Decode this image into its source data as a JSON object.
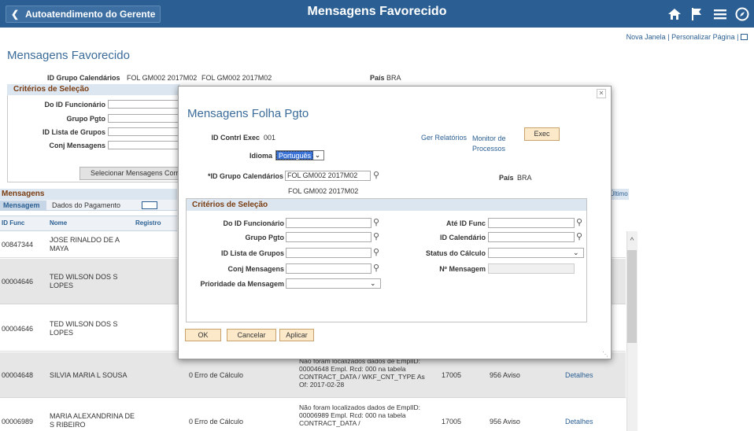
{
  "header": {
    "back_label": "Autoatendimento do Gerente",
    "title": "Mensagens Favorecido"
  },
  "page_links": {
    "new_window": "Nova Janela",
    "separator": "|",
    "personalize": "Personalizar Página",
    "separator2": "|"
  },
  "background": {
    "title": "Mensagens Favorecido",
    "id_grupo_label": "ID Grupo Calendários",
    "id_grupo_value": "FOL GM002 2017M02",
    "id_grupo_desc": "FOL GM002 2017M02",
    "pais_label": "País",
    "pais_value": "BRA",
    "criteria_title": "Critérios de Seleção",
    "fields": [
      "Do ID Funcionário",
      "Grupo Pgto",
      "ID Lista de Grupos",
      "Conj Mensagens"
    ],
    "select_button": "Selecionar Mensagens Correspondentes",
    "messages_title": "Mensagens",
    "ultimo": "Último",
    "tabs": [
      "Mensagem",
      "Dados do Pagamento"
    ],
    "columns": [
      "ID Func",
      "Nome",
      "Registro"
    ],
    "rows": [
      {
        "id": "00847344",
        "name": "JOSE RINALDO DE A MAYA"
      },
      {
        "id": "00004646",
        "name": "TED WILSON DOS S LOPES"
      },
      {
        "id": "00004646",
        "name": "TED WILSON DOS S LOPES"
      },
      {
        "id": "00004648",
        "name": "SILVIA MARIA L SOUSA",
        "reg": "0",
        "error": "Erro de Cálculo",
        "msg": "Não foram localizados dados de EmplID: 00004648 Empl. Rcd: 000 na tabela CONTRACT_DATA / WKF_CNT_TYPE As Of: 2017-02-28",
        "set": "17005",
        "num": "956",
        "sev": "Aviso",
        "detail": "Detalhes"
      },
      {
        "id": "00006989",
        "name": "MARIA ALEXANDRINA DE S RIBEIRO",
        "reg": "0",
        "error": "Erro de Cálculo",
        "msg": "Não foram localizados dados de EmplID: 00006989 Empl. Rcd: 000 na tabela CONTRACT_DATA /",
        "set": "17005",
        "num": "956",
        "sev": "Aviso",
        "detail": "Detalhes"
      }
    ]
  },
  "modal": {
    "title": "Mensagens Folha Pgto",
    "run_control_label": "ID Contrl Exec",
    "run_control_value": "001",
    "report_link": "Ger Relatórios",
    "process_monitor_link": "Monitor de Processos",
    "exec_button": "Exec",
    "language_label": "Idioma",
    "language_value": "Português",
    "calendar_group_label": "*ID Grupo Calendários",
    "calendar_group_value": "FOL GM002 2017M02",
    "calendar_group_desc": "FOL GM002 2017M02",
    "country_label": "País",
    "country_value": "BRA",
    "criteria_title": "Critérios de Seleção",
    "left_fields": [
      "Do ID Funcionário",
      "Grupo Pgto",
      "ID Lista de Grupos",
      "Conj Mensagens"
    ],
    "priority_label": "Prioridade da Mensagem",
    "right_fields": [
      "Até ID Func",
      "ID Calendário",
      "Status do Cálculo",
      "Nº Mensagem"
    ],
    "ok_button": "OK",
    "cancel_button": "Cancelar",
    "apply_button": "Aplicar"
  }
}
